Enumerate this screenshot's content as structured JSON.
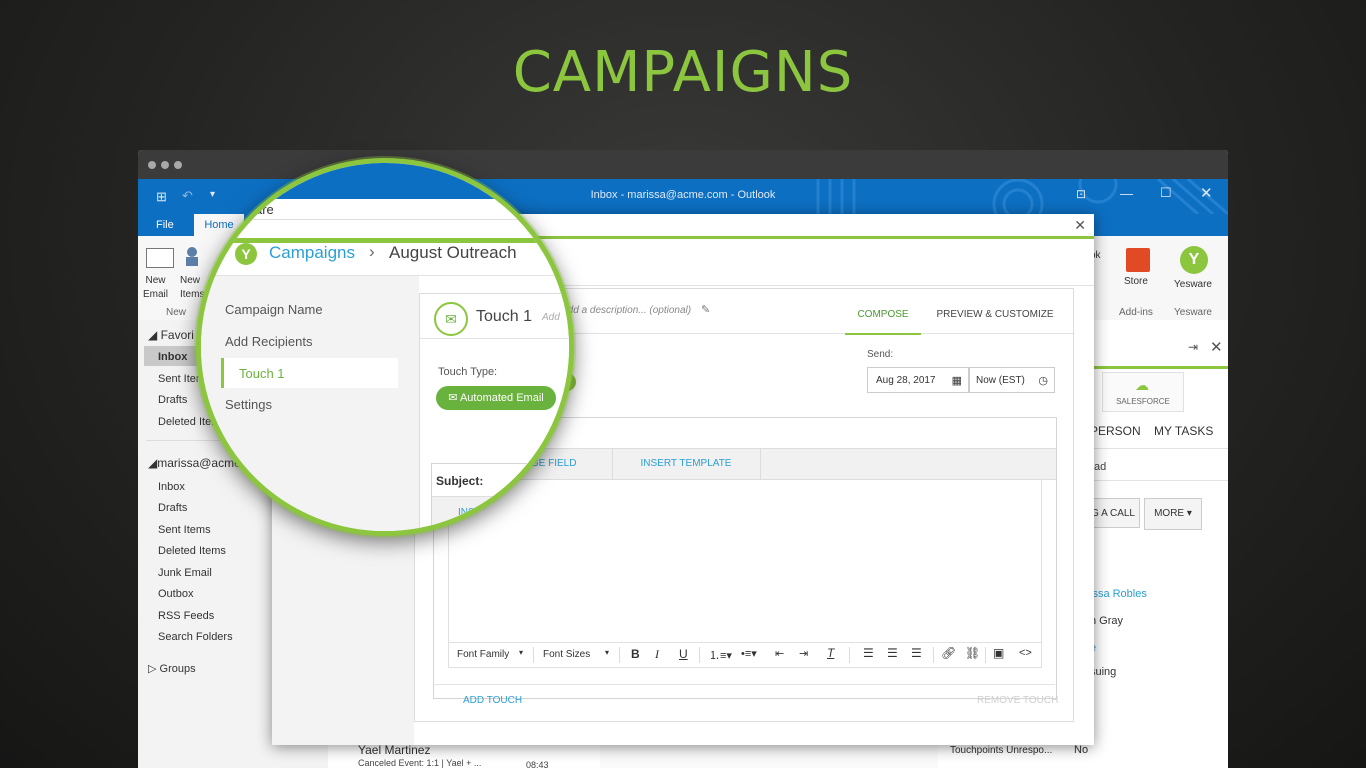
{
  "headline": "CAMPAIGNS",
  "outlook": {
    "window_title": "Inbox - marissa@acme.com - Outlook",
    "tabs": {
      "file": "File",
      "home": "Home"
    },
    "ribbon": {
      "new_email": "New\nEmail",
      "new_items": "New\nItems",
      "group_new": "New",
      "store": "Store",
      "yesware": "Yesware",
      "group_addins": "Add-ins",
      "group_yesware": "Yesware",
      "book": "ok"
    },
    "folders": {
      "favorites_header": "Favori",
      "fav_items": [
        "Inbox",
        "Sent Item",
        "Drafts",
        "Deleted Iter"
      ],
      "account_header": "marissa@acme",
      "items": [
        "Inbox",
        "Drafts",
        "Sent Items",
        "Deleted Items",
        "Junk Email",
        "Outbox",
        "RSS Feeds",
        "Search Folders"
      ],
      "groups": "Groups"
    },
    "message": {
      "sender": "Yael Martinez",
      "subject": "Canceled Event: 1:1 | Yael + ...",
      "time": "08:43"
    },
    "right_pane": {
      "salesforce": "SALESFORCE",
      "tab_person": "PERSON",
      "tab_tasks": "MY TASKS",
      "lead": "ad",
      "log_call": "G A CALL",
      "more": "MORE",
      "contacts": [
        "issa Robles",
        "n Gray",
        "e",
        "suing"
      ],
      "touchpoints_label": "Touchpoints Unrespo...",
      "touchpoints_value": "No"
    }
  },
  "modal": {
    "breadcrumb_root": "Campaigns",
    "breadcrumb_current": "August Outreach",
    "nav": [
      "Campaign Name",
      "Add Recipients",
      "Touch 1",
      "Settings"
    ],
    "touch_title": "Touch 1",
    "description_placeholder": "Add a description... (optional)",
    "tabs": {
      "compose": "COMPOSE",
      "preview": "PREVIEW & CUSTOMIZE"
    },
    "touch_type_label": "Touch Type:",
    "touch_type_value": "Automated Email",
    "send_label": "Send:",
    "send_date": "Aug 28, 2017",
    "send_time": "Now (EST)",
    "subject_label": "Subject:",
    "insert_merge": "INSERT MERGE FIELD",
    "insert_template": "INSERT TEMPLATE",
    "font_family": "Font Family",
    "font_sizes": "Font Sizes",
    "add_touch": "ADD TOUCH",
    "remove_touch": "REMOVE TOUCH"
  },
  "magnifier": {
    "yesware_text": "are",
    "insert": "INSERT"
  },
  "colors": {
    "accent": "#8cc63f",
    "outlook_blue": "#0d6fc2",
    "link_blue": "#2a9fd6"
  }
}
